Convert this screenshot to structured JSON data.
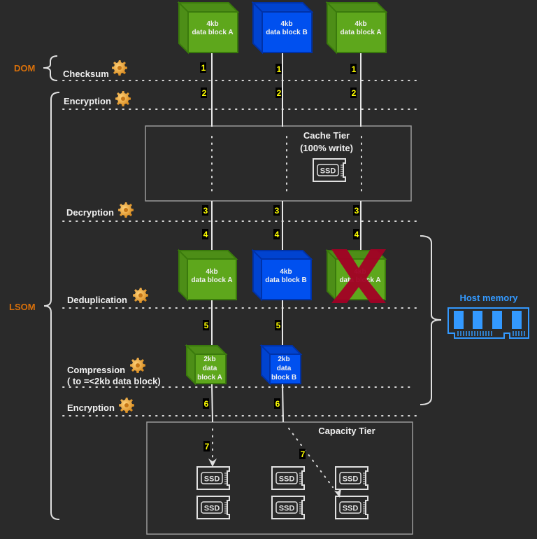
{
  "labels": {
    "dom": "DOM",
    "lsom": "LSOM",
    "checksum": "Checksum",
    "encryption1": "Encryption",
    "decryption": "Decryption",
    "deduplication": "Deduplication",
    "compression": "Compression",
    "compression_note": "( to =<2kb data block)",
    "encryption2": "Encryption",
    "host_memory": "Host memory"
  },
  "cache_tier": {
    "title": "Cache Tier",
    "subtitle": "(100% write)",
    "ssd": "SSD"
  },
  "capacity_tier": {
    "title": "Capacity Tier",
    "ssd": "SSD"
  },
  "blocks": {
    "top": [
      {
        "size": "4kb",
        "name": "data block A",
        "color": "#5ea71c"
      },
      {
        "size": "4kb",
        "name": "data block B",
        "color": "#0050ef"
      },
      {
        "size": "4kb",
        "name": "data block A",
        "color": "#5ea71c"
      }
    ],
    "dedup": [
      {
        "size": "4kb",
        "name": "data block A",
        "color": "#5ea71c"
      },
      {
        "size": "4kb",
        "name": "data block B",
        "color": "#0050ef"
      },
      {
        "size": "4kb",
        "name": "data block A",
        "color": "#5ea71c",
        "removed": true
      }
    ],
    "compressed": [
      {
        "size": "2kb",
        "l1": "data",
        "l2": "block A",
        "color": "#5ea71c"
      },
      {
        "size": "2kb",
        "l1": "data",
        "l2": "block B",
        "color": "#0050ef"
      }
    ]
  },
  "steps": [
    "1",
    "2",
    "3",
    "4",
    "5",
    "6",
    "7"
  ],
  "colors": {
    "background": "#2a2a2a",
    "layer_label": "#d9700a",
    "host_memory": "#3399ff",
    "step_badge": "#ffff00",
    "removed_mark": "#a20025"
  },
  "icons": [
    "gear-icon",
    "ssd-icon",
    "ram-icon",
    "x-mark-icon"
  ]
}
